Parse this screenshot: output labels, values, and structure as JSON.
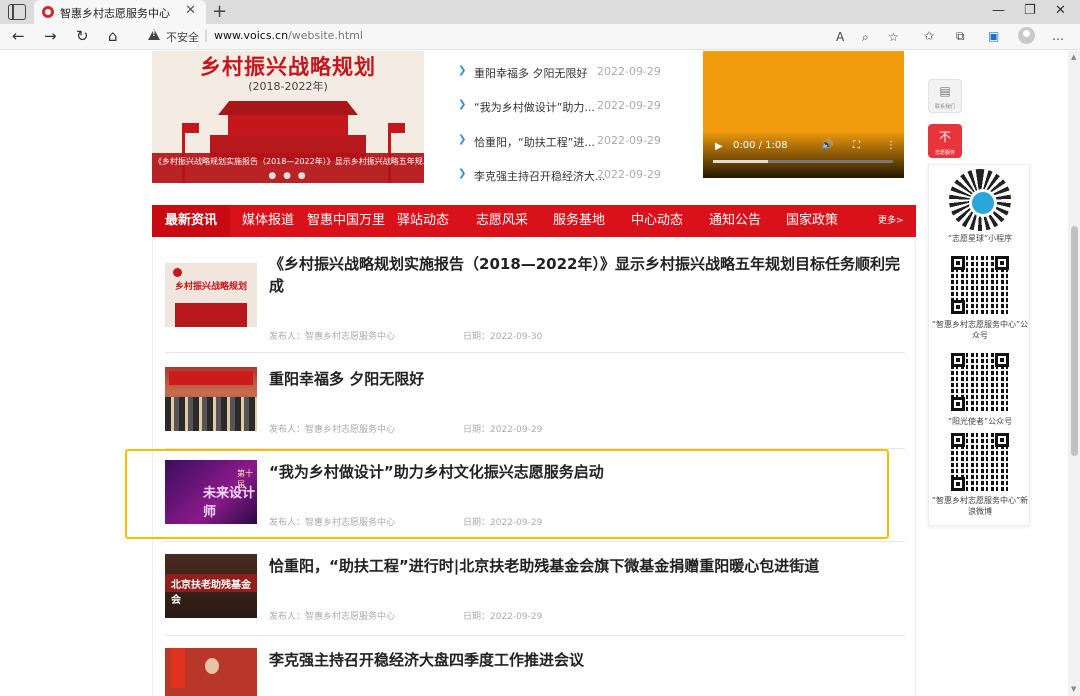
{
  "browser": {
    "tab_title": "智惠乡村志愿服务中心",
    "tab_close": "✕",
    "new_tab": "+",
    "not_secure": "不安全",
    "url_host": "www.voics.cn",
    "url_path": "/website.html",
    "window_controls": [
      "—",
      "❐",
      "✕"
    ]
  },
  "banner": {
    "title": "乡村振兴战略规划",
    "years": "(2018-2022年)",
    "caption": "《乡村振兴战略规划实施报告（2018—2022年）》显示乡村振兴战略五年规...",
    "dots": "● ● ●"
  },
  "top_news": [
    {
      "title": "重阳幸福多 夕阳无限好",
      "date": "2022-09-29"
    },
    {
      "title": "“我为乡村做设计”助力...",
      "date": "2022-09-29"
    },
    {
      "title": "恰重阳，“助扶工程”进...",
      "date": "2022-09-29"
    },
    {
      "title": "李克强主持召开稳经济大...",
      "date": "2022-09-29"
    }
  ],
  "video": {
    "time": "0:00 / 1:08",
    "play_icon": "▶",
    "volume_icon": "🔊",
    "fullscreen_icon": "⛶",
    "more_icon": "⋮"
  },
  "nav": {
    "first": "最新资讯",
    "items": [
      "媒体报道",
      "智惠中国万里",
      "驿站动态",
      "志愿风采",
      "服务基地",
      "中心动态",
      "通知公告",
      "国家政策"
    ],
    "more": "更多>"
  },
  "articles": [
    {
      "title": "《乡村振兴战略规划实施报告（2018—2022年）》显示乡村振兴战略五年规划目标任务顺利完成",
      "publisher": "发布人：智惠乡村志愿服务中心",
      "date": "日期：2022-09-30"
    },
    {
      "title": "重阳幸福多 夕阳无限好",
      "publisher": "发布人：智惠乡村志愿服务中心",
      "date": "日期：2022-09-29"
    },
    {
      "title": "“我为乡村做设计”助力乡村文化振兴志愿服务启动",
      "publisher": "发布人：智惠乡村志愿服务中心",
      "date": "日期：2022-09-29"
    },
    {
      "title": "恰重阳，“助扶工程”进行时|北京扶老助残基金会旗下微基金捐赠重阳暖心包进街道",
      "publisher": "发布人：智惠乡村志愿服务中心",
      "date": "日期：2022-09-29"
    },
    {
      "title": "李克强主持召开稳经济大盘四季度工作推进会议",
      "publisher": "",
      "date": ""
    }
  ],
  "thumbs": {
    "t1_title": "乡村振兴战略规划",
    "t3_main": "未来设计师",
    "t3_sub": "第十届",
    "t4_text": "北京扶老助残基金会"
  },
  "side": {
    "btn1_label": "联系我们",
    "btn2_label": "志愿服务",
    "btn2_icon": "不",
    "qrs": [
      {
        "label": "“志愿星球”小程序"
      },
      {
        "label": "“智惠乡村志愿服务中心”公众号"
      },
      {
        "label": "“阳光使者”公众号"
      },
      {
        "label": "“智惠乡村志愿服务中心”新浪微博"
      }
    ]
  }
}
